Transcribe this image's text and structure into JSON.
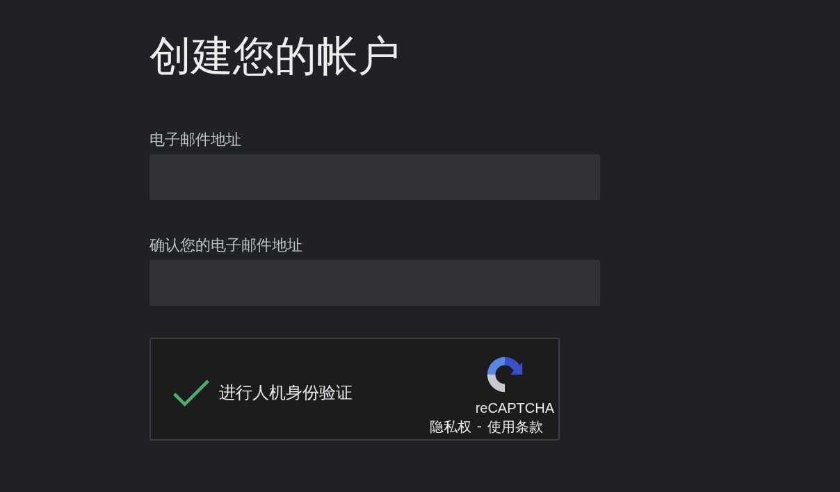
{
  "title": "创建您的帐户",
  "fields": [
    {
      "label": "电子邮件地址"
    },
    {
      "label": "确认您的电子邮件地址"
    }
  ],
  "captcha": {
    "checked": true,
    "label": "进行人机身份验证",
    "brand": "reCAPTCHA",
    "privacy_link": "隐私权",
    "separator": "-",
    "terms_link": "使用条款"
  }
}
